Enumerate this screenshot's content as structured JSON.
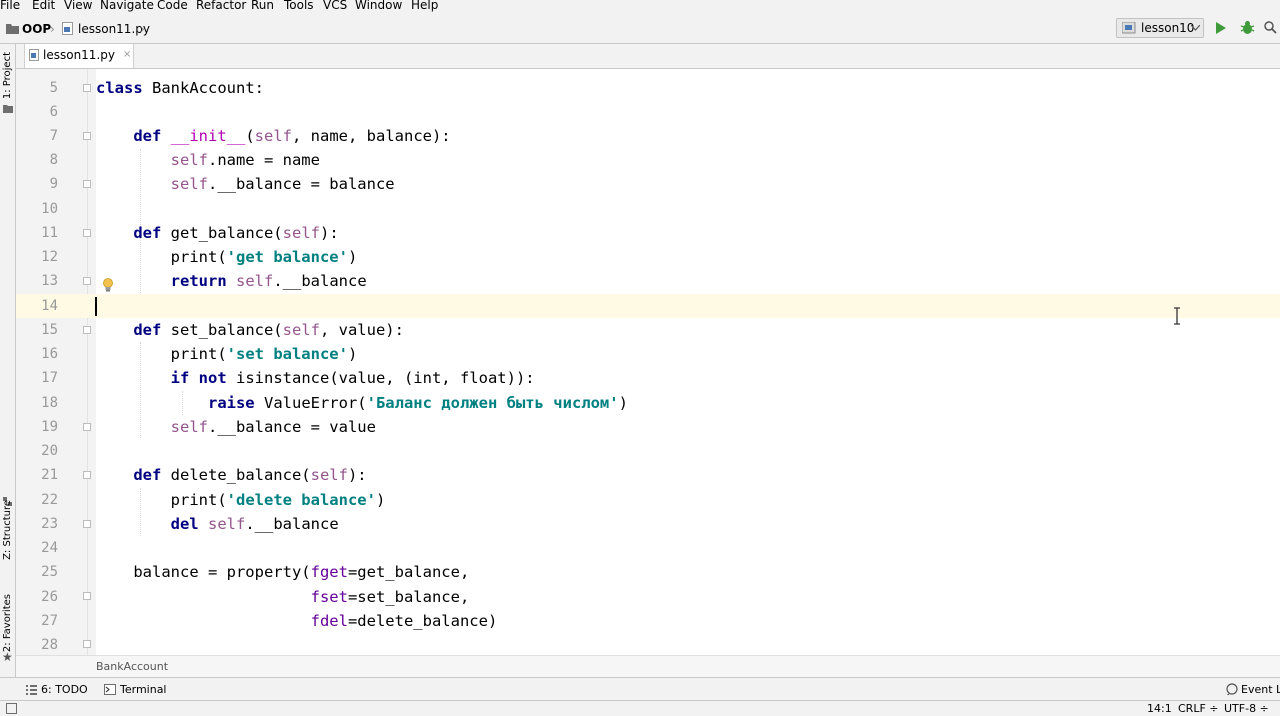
{
  "menu": [
    "File",
    "Edit",
    "View",
    "Navigate",
    "Code",
    "Refactor",
    "Run",
    "Tools",
    "VCS",
    "Window",
    "Help"
  ],
  "breadcrumb": {
    "project": "OOP",
    "file": "lesson11.py"
  },
  "run_config": {
    "name": "lesson10"
  },
  "left_tools": {
    "project": "1: Project",
    "structure": "Z: Structure",
    "favorites": "2: Favorites"
  },
  "tab": {
    "label": "lesson11.py",
    "close": "×"
  },
  "editor": {
    "line_numbers": [
      "5",
      "6",
      "7",
      "8",
      "9",
      "10",
      "11",
      "12",
      "13",
      "14",
      "15",
      "16",
      "17",
      "18",
      "19",
      "20",
      "21",
      "22",
      "23",
      "24",
      "25",
      "26",
      "27",
      "28"
    ],
    "current_line": "14"
  },
  "code_breadcrumb": "BankAccount",
  "bottom_tools": {
    "todo": "6: TODO",
    "terminal": "Terminal",
    "event_log": "Event Lo"
  },
  "status": {
    "position": "14:1",
    "line_sep": "CRLF ÷",
    "encoding": "UTF-8 ÷"
  },
  "colors": {
    "keyword": "#000080",
    "string": "#008080",
    "self": "#94558d",
    "current_line": "#fffae3",
    "run": "#3e9a3a"
  },
  "icons": [
    "folder-icon",
    "python-file-icon",
    "run-icon",
    "debug-icon",
    "search-icon",
    "lightbulb-icon",
    "fold-marker-icon",
    "todo-icon",
    "terminal-icon",
    "event-log-icon",
    "star-icon",
    "structure-icon"
  ]
}
